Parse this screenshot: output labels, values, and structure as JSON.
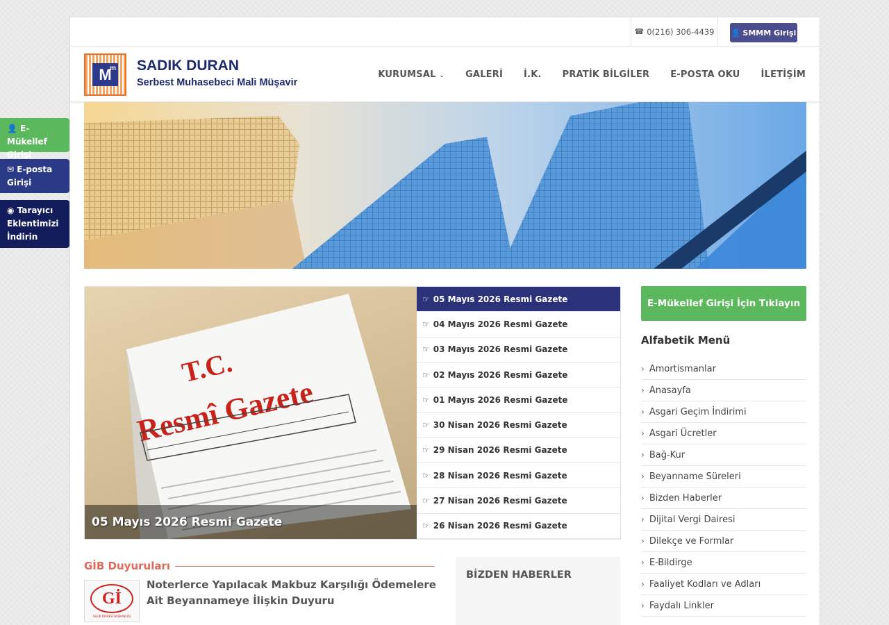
{
  "topbar": {
    "phone_icon": "phone-icon",
    "phone": "0(216) 306-4439",
    "smmm_icon": "user-icon",
    "smmm_label": "SMMM Girişi"
  },
  "brand": {
    "logo_text": "M",
    "logo_sup": "m",
    "name": "SADIK DURAN",
    "subtitle": "Serbest Muhasebeci Mali Müşavir"
  },
  "nav": {
    "items": [
      "KURUMSAL",
      "GALERİ",
      "İ.K.",
      "PRATİK BİLGİLER",
      "E-POSTA OKU",
      "İLETİŞİM"
    ],
    "dropdown_icon": "chevron-down-icon"
  },
  "float_buttons": [
    {
      "icon": "user-icon",
      "label": "E-Mükellef Girişi",
      "color": "#5cb85c"
    },
    {
      "icon": "envelope-icon",
      "label": "E-posta Girişi",
      "color": "#2b3a86"
    },
    {
      "icon": "chrome-icon",
      "label": "Tarayıcı Eklentimizi İndirin",
      "color": "#131d5b"
    }
  ],
  "slider": {
    "image_text_line1": "T.C.",
    "image_text_line2": "Resmî Gazete",
    "caption": "05 Mayıs 2026 Resmi Gazete",
    "items": [
      "05 Mayıs 2026 Resmi Gazete",
      "04 Mayıs 2026 Resmi Gazete",
      "03 Mayıs 2026 Resmi Gazete",
      "02 Mayıs 2026 Resmi Gazete",
      "01 Mayıs 2026 Resmi Gazete",
      "30 Nisan 2026 Resmi Gazete",
      "29 Nisan 2026 Resmi Gazete",
      "28 Nisan 2026 Resmi Gazete",
      "27 Nisan 2026 Resmi Gazete",
      "26 Nisan 2026 Resmi Gazete"
    ],
    "active_index": 0
  },
  "sidebar": {
    "emukellef_button": "E-Mükellef Girişi İçin Tıklayın",
    "alfabetik_title": "Alfabetik Menü",
    "alfabetik_items": [
      "Amortismanlar",
      "Anasayfa",
      "Asgari Geçim İndirimi",
      "Asgari Ücretler",
      "Bağ-Kur",
      "Beyanname Süreleri",
      "Bizden Haberler",
      "Dijital Vergi Dairesi",
      "Dilekçe ve Formlar",
      "E-Bildirge",
      "Faaliyet Kodları ve Adları",
      "Faydalı Linkler"
    ]
  },
  "gib": {
    "title": "GİB Duyuruları",
    "news_title": "Noterlerce Yapılacak Makbuz Karşılığı Ödemelere Ait Beyannameye İlişkin Duyuru",
    "logo_caption": "GELİR İDARESİ BAŞKANLIĞI"
  },
  "bizden": {
    "title": "BİZDEN HABERLER"
  },
  "colors": {
    "brand_navy": "#1e2a6e",
    "active_item": "#2b327a",
    "green": "#5cb85c",
    "gib_red": "#e06a5a"
  }
}
